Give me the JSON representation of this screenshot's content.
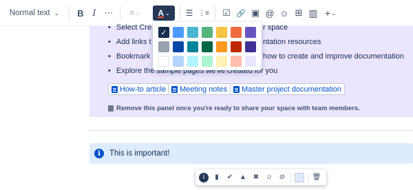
{
  "toolbar": {
    "text_style": "Normal text",
    "text_style_chevron": "⌄",
    "bold": "B",
    "italic": "I",
    "more": "⋯",
    "align": "≡",
    "align_chevron": "⌄",
    "text_color_letter": "A",
    "text_color_chevron": "⌄",
    "bullet_list": "☰",
    "numbered_list": "⋮≡",
    "action": "☑",
    "link": "🔗",
    "image": "▣",
    "mention": "@",
    "emoji": "☺",
    "table": "⊞",
    "layout": "▥",
    "insert": "+",
    "insert_chevron": "⌄"
  },
  "content": {
    "bullets": [
      "Select Cre",
      "Add links t",
      "Bookmark",
      "Explore the sample pages we've created for you"
    ],
    "bullets_tail": [
      "r space",
      "ntation resources",
      "how to create and improve documentation"
    ],
    "bullet_symbol": "•",
    "links": [
      "How-to article",
      "Meeting notes",
      "Master project documentation"
    ],
    "note": "Remove this panel once you're ready to share your space with team members.",
    "info_text": "This is important!",
    "info_icon": "i"
  },
  "color_picker": {
    "selected_check": "✓",
    "rows": [
      [
        "#172b4d",
        "#4c9aff",
        "#4bb5d1",
        "#57b37c",
        "#f6c342",
        "#f06b3f",
        "#6554c0"
      ],
      [
        "#97a0af",
        "#0747a6",
        "#00849a",
        "#006644",
        "#ff991f",
        "#bf2600",
        "#403294"
      ],
      [
        "#ffffff",
        "#b3d4ff",
        "#b3f5ff",
        "#abf5d1",
        "#fff0b3",
        "#ffbdad",
        "#eae6ff"
      ]
    ]
  },
  "float_bar": {
    "info": "i",
    "note": "▮",
    "success": "✔",
    "warning": "▲",
    "error": "✖",
    "custom": "☺",
    "no_icon": "⊘",
    "delete": "🗑"
  }
}
